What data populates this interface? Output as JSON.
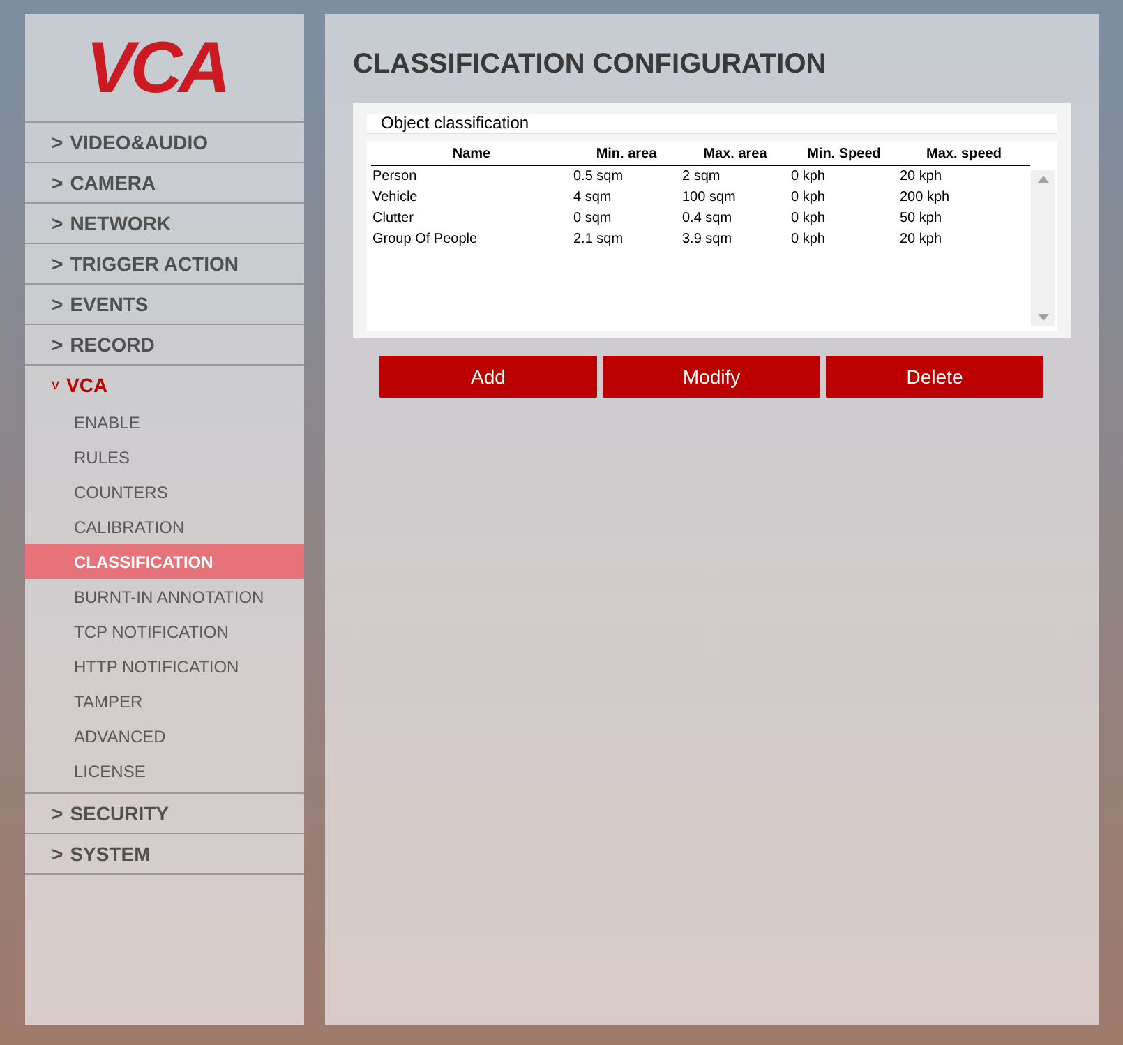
{
  "logo": "VCA",
  "sidebar": {
    "items": [
      {
        "marker": ">",
        "label": "VIDEO&AUDIO",
        "expanded": false
      },
      {
        "marker": ">",
        "label": "CAMERA",
        "expanded": false
      },
      {
        "marker": ">",
        "label": "NETWORK",
        "expanded": false
      },
      {
        "marker": ">",
        "label": "TRIGGER ACTION",
        "expanded": false
      },
      {
        "marker": ">",
        "label": "EVENTS",
        "expanded": false
      },
      {
        "marker": ">",
        "label": "RECORD",
        "expanded": false
      },
      {
        "marker": "v",
        "label": "VCA",
        "expanded": true,
        "children": [
          {
            "label": "ENABLE",
            "selected": false
          },
          {
            "label": "RULES",
            "selected": false
          },
          {
            "label": "COUNTERS",
            "selected": false
          },
          {
            "label": "CALIBRATION",
            "selected": false
          },
          {
            "label": "CLASSIFICATION",
            "selected": true
          },
          {
            "label": "BURNT-IN ANNOTATION",
            "selected": false
          },
          {
            "label": "TCP NOTIFICATION",
            "selected": false
          },
          {
            "label": "HTTP NOTIFICATION",
            "selected": false
          },
          {
            "label": "TAMPER",
            "selected": false
          },
          {
            "label": "ADVANCED",
            "selected": false
          },
          {
            "label": "LICENSE",
            "selected": false
          }
        ]
      },
      {
        "marker": ">",
        "label": "SECURITY",
        "expanded": false
      },
      {
        "marker": ">",
        "label": "SYSTEM",
        "expanded": false
      }
    ]
  },
  "page_title": "CLASSIFICATION CONFIGURATION",
  "panel": {
    "title": "Object classification",
    "table": {
      "columns": [
        "Name",
        "Min. area",
        "Max. area",
        "Min. Speed",
        "Max. speed"
      ],
      "rows": [
        [
          "Person",
          "0.5 sqm",
          "2 sqm",
          "0 kph",
          "20 kph"
        ],
        [
          "Vehicle",
          "4 sqm",
          "100 sqm",
          "0 kph",
          "200 kph"
        ],
        [
          "Clutter",
          "0 sqm",
          "0.4 sqm",
          "0 kph",
          "50 kph"
        ],
        [
          "Group Of People",
          "2.1 sqm",
          "3.9 sqm",
          "0 kph",
          "20 kph"
        ]
      ]
    }
  },
  "buttons": [
    "Add",
    "Modify",
    "Delete"
  ]
}
